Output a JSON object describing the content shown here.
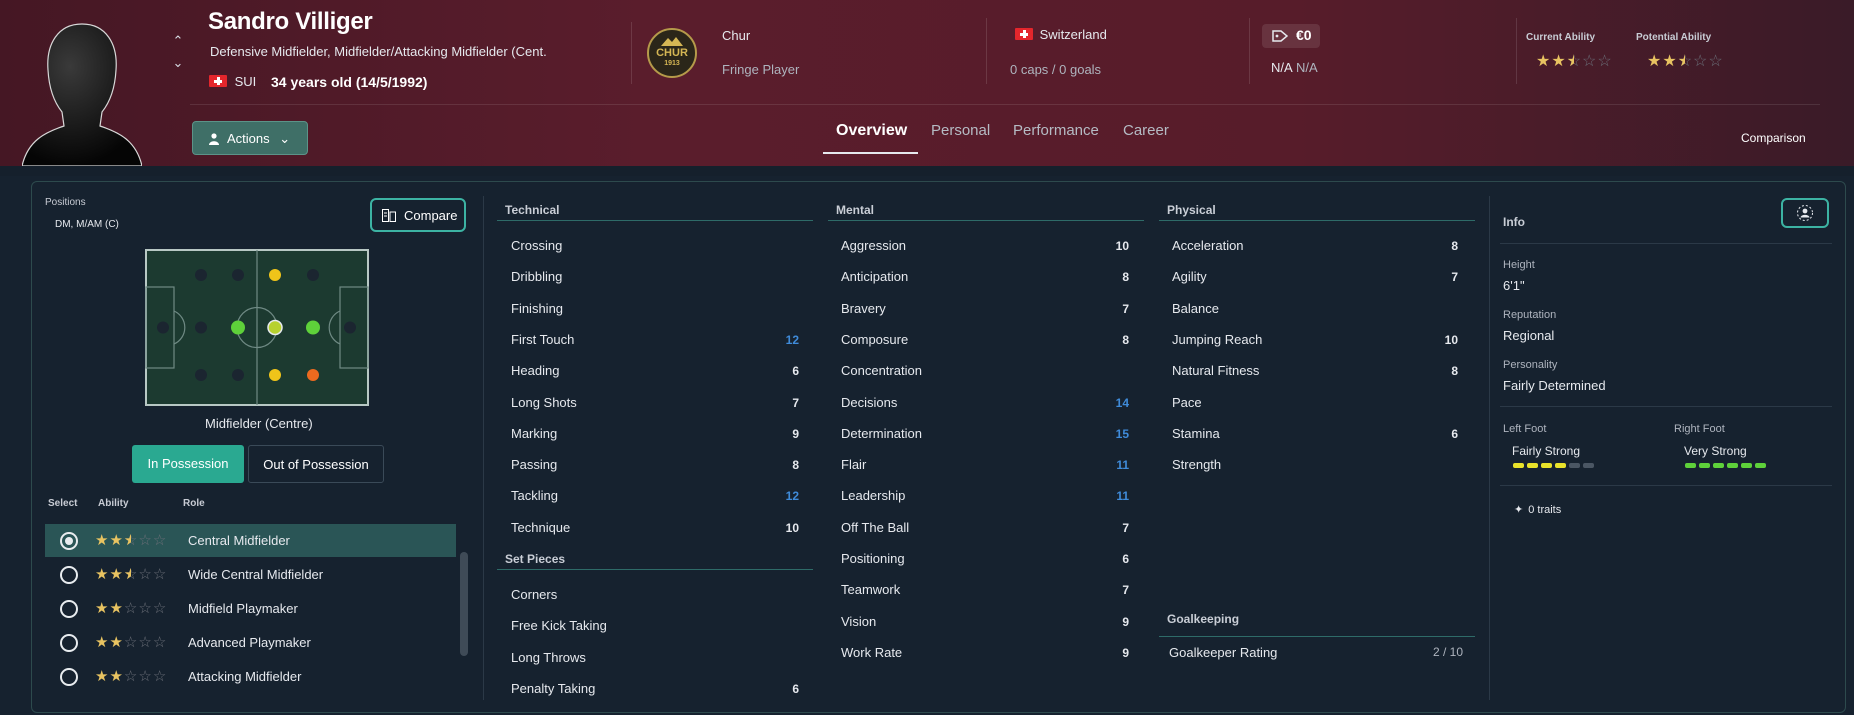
{
  "player": {
    "name": "Sandro Villiger",
    "positions_full": "Defensive Midfielder, Midfielder/Attacking Midfielder (Cent...",
    "nationality_code": "SUI",
    "age": "34 years old (14/5/1992)"
  },
  "club": {
    "badge_text": "CHUR",
    "badge_year": "1913",
    "name": "Chur",
    "status": "Fringe Player"
  },
  "country": {
    "name": "Switzerland",
    "caps": "0 caps / 0 goals"
  },
  "value": {
    "amount": "€0",
    "wage": "N/A",
    "contract": "N/A"
  },
  "ability": {
    "current_label": "Current Ability",
    "current_stars": 2.5,
    "potential_label": "Potential Ability",
    "potential_stars": 2.5
  },
  "header": {
    "actions_label": "Actions",
    "tabs": [
      "Overview",
      "Personal",
      "Performance",
      "Career"
    ],
    "active_tab": "Overview",
    "comparison_label": "Comparison"
  },
  "positions_panel": {
    "label": "Positions",
    "value": "DM, M/AM (C)",
    "compare_label": "Compare",
    "role_title": "Midfielder (Centre)",
    "in_possession": "In Possession",
    "out_possession": "Out of Possession",
    "col_select": "Select",
    "col_ability": "Ability",
    "col_role": "Role",
    "roles": [
      {
        "name": "Central Midfielder",
        "stars": 2.5,
        "selected": true
      },
      {
        "name": "Wide Central Midfielder",
        "stars": 2.5,
        "selected": false
      },
      {
        "name": "Midfield Playmaker",
        "stars": 2,
        "selected": false
      },
      {
        "name": "Advanced Playmaker",
        "stars": 2,
        "selected": false
      },
      {
        "name": "Attacking Midfielder",
        "stars": 2,
        "selected": false
      }
    ]
  },
  "technical": {
    "title": "Technical",
    "items": [
      {
        "name": "Crossing",
        "value": ""
      },
      {
        "name": "Dribbling",
        "value": ""
      },
      {
        "name": "Finishing",
        "value": ""
      },
      {
        "name": "First Touch",
        "value": "12",
        "highlight": true
      },
      {
        "name": "Heading",
        "value": "6"
      },
      {
        "name": "Long Shots",
        "value": "7"
      },
      {
        "name": "Marking",
        "value": "9"
      },
      {
        "name": "Passing",
        "value": "8"
      },
      {
        "name": "Tackling",
        "value": "12",
        "highlight": true
      },
      {
        "name": "Technique",
        "value": "10"
      }
    ]
  },
  "set_pieces": {
    "title": "Set Pieces",
    "items": [
      {
        "name": "Corners",
        "value": ""
      },
      {
        "name": "Free Kick Taking",
        "value": ""
      },
      {
        "name": "Long Throws",
        "value": ""
      },
      {
        "name": "Penalty Taking",
        "value": "6"
      }
    ]
  },
  "mental": {
    "title": "Mental",
    "items": [
      {
        "name": "Aggression",
        "value": "10"
      },
      {
        "name": "Anticipation",
        "value": "8"
      },
      {
        "name": "Bravery",
        "value": "7"
      },
      {
        "name": "Composure",
        "value": "8"
      },
      {
        "name": "Concentration",
        "value": ""
      },
      {
        "name": "Decisions",
        "value": "14",
        "highlight": true
      },
      {
        "name": "Determination",
        "value": "15",
        "highlight": true
      },
      {
        "name": "Flair",
        "value": "11",
        "highlight": true
      },
      {
        "name": "Leadership",
        "value": "11",
        "highlight": true
      },
      {
        "name": "Off The Ball",
        "value": "7"
      },
      {
        "name": "Positioning",
        "value": "6"
      },
      {
        "name": "Teamwork",
        "value": "7"
      },
      {
        "name": "Vision",
        "value": "9"
      },
      {
        "name": "Work Rate",
        "value": "9"
      }
    ]
  },
  "physical": {
    "title": "Physical",
    "items": [
      {
        "name": "Acceleration",
        "value": "8"
      },
      {
        "name": "Agility",
        "value": "7"
      },
      {
        "name": "Balance",
        "value": ""
      },
      {
        "name": "Jumping Reach",
        "value": "10"
      },
      {
        "name": "Natural Fitness",
        "value": "8"
      },
      {
        "name": "Pace",
        "value": ""
      },
      {
        "name": "Stamina",
        "value": "6"
      },
      {
        "name": "Strength",
        "value": ""
      }
    ]
  },
  "goalkeeping": {
    "title": "Goalkeeping",
    "rating_label": "Goalkeeper Rating",
    "rating_value": "2 / 10"
  },
  "info": {
    "title": "Info",
    "height_label": "Height",
    "height": "6'1\"",
    "reputation_label": "Reputation",
    "reputation": "Regional",
    "personality_label": "Personality",
    "personality": "Fairly Determined",
    "left_foot_label": "Left Foot",
    "left_foot": "Fairly Strong",
    "left_foot_level": 4,
    "right_foot_label": "Right Foot",
    "right_foot": "Very Strong",
    "right_foot_level": 6,
    "traits": "0 traits"
  },
  "colors": {
    "accent": "#3cb3a3",
    "star": "#e8c361",
    "highlight_value": "#3f8bd9",
    "pitch": "#1c3a30"
  }
}
